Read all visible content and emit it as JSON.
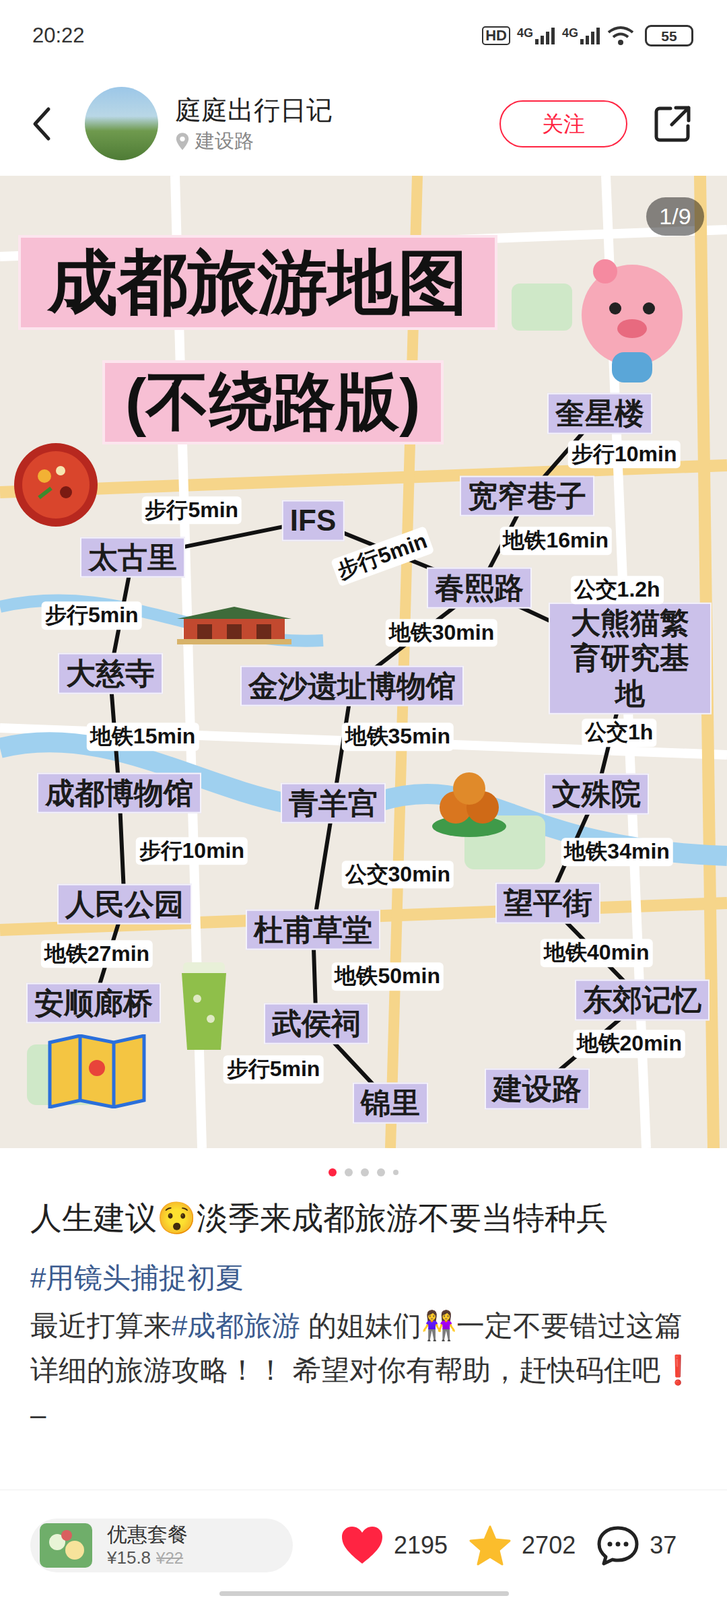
{
  "status_bar": {
    "time": "20:22",
    "hd": "HD",
    "networks": [
      "4G",
      "4G"
    ],
    "battery": "55"
  },
  "author": {
    "name": "庭庭出行日记",
    "location": "建设路",
    "follow_button": "关注"
  },
  "post_image": {
    "page": "1/9",
    "title_lines": [
      "成都旅游地图",
      "(不绕路版)"
    ],
    "places": [
      "奎星楼",
      "宽窄巷子",
      "IFS",
      "太古里",
      "春熙路",
      "大熊猫繁育研究基地",
      "大慈寺",
      "金沙遗址博物馆",
      "成都博物馆",
      "青羊宫",
      "文殊院",
      "人民公园",
      "杜甫草堂",
      "望平街",
      "安顺廊桥",
      "东郊记忆",
      "武侯祠",
      "锦里",
      "建设路"
    ],
    "legs": [
      "步行10min",
      "地铁16min",
      "步行5min",
      "步行5min",
      "公交1.2h",
      "步行5min",
      "地铁30min",
      "地铁15min",
      "地铁35min",
      "公交1h",
      "步行10min",
      "地铁34min",
      "公交30min",
      "地铁27min",
      "地铁40min",
      "地铁50min",
      "地铁20min",
      "步行5min"
    ]
  },
  "carousel_dots": [
    {
      "selected": true
    },
    {
      "selected": false
    },
    {
      "selected": false
    },
    {
      "selected": false
    },
    {
      "selected": false
    }
  ],
  "post": {
    "title": "人生建议😯淡季来成都旅游不要当特种兵",
    "topic": "#用镜头捕捉初夏",
    "body": [
      {
        "text": "最近打算来",
        "kind": "plain"
      },
      {
        "text": "#成都旅游",
        "kind": "tag"
      },
      {
        "text": " 的姐妹们👭一定不要错过这篇详细的旅游攻略！！ 希望对你有帮助，赶快码住吧❗",
        "kind": "plain"
      }
    ],
    "trailing": "–"
  },
  "bottom_bar": {
    "coupon": {
      "label": "优惠套餐",
      "price": "¥15.8",
      "original_price": "¥22"
    },
    "likes": "2195",
    "favorites": "2702",
    "comments": "37"
  }
}
